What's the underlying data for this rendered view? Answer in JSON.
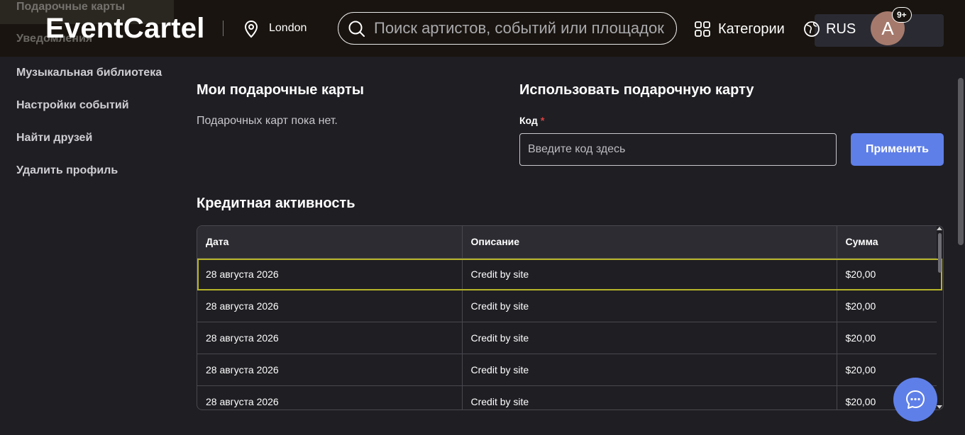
{
  "header": {
    "brand": "EventCartel",
    "location": "London",
    "search_placeholder": "Поиск артистов, событий или площадок",
    "categories_label": "Категории",
    "language_label": "RUS",
    "avatar_letter": "A",
    "notification_badge": "9+"
  },
  "sidebar": {
    "items": [
      {
        "label": "Подарочные карты"
      },
      {
        "label": "Уведомления"
      },
      {
        "label": "Музыкальная библиотека"
      },
      {
        "label": "Настройки событий"
      },
      {
        "label": "Найти друзей"
      },
      {
        "label": "Удалить профиль"
      }
    ]
  },
  "gift_cards": {
    "title": "Мои подарочные карты",
    "empty_text": "Подарочных карт пока нет."
  },
  "redeem": {
    "title": "Использовать подарочную карту",
    "code_label": "Код",
    "required_mark": "*",
    "code_placeholder": "Введите код здесь",
    "apply_label": "Применить"
  },
  "credit_activity": {
    "title": "Кредитная активность",
    "columns": [
      "Дата",
      "Описание",
      "Сумма"
    ],
    "rows": [
      {
        "date": "28 августа 2026",
        "description": "Credit by site",
        "amount": "$20,00"
      },
      {
        "date": "28 августа 2026",
        "description": "Credit by site",
        "amount": "$20,00"
      },
      {
        "date": "28 августа 2026",
        "description": "Credit by site",
        "amount": "$20,00"
      },
      {
        "date": "28 августа 2026",
        "description": "Credit by site",
        "amount": "$20,00"
      },
      {
        "date": "28 августа 2026",
        "description": "Credit by site",
        "amount": "$20,00"
      }
    ]
  },
  "colors": {
    "background": "#1f1e23",
    "header": "#19140f",
    "accent": "#5f7fe8",
    "selection": "#b7b42a"
  }
}
